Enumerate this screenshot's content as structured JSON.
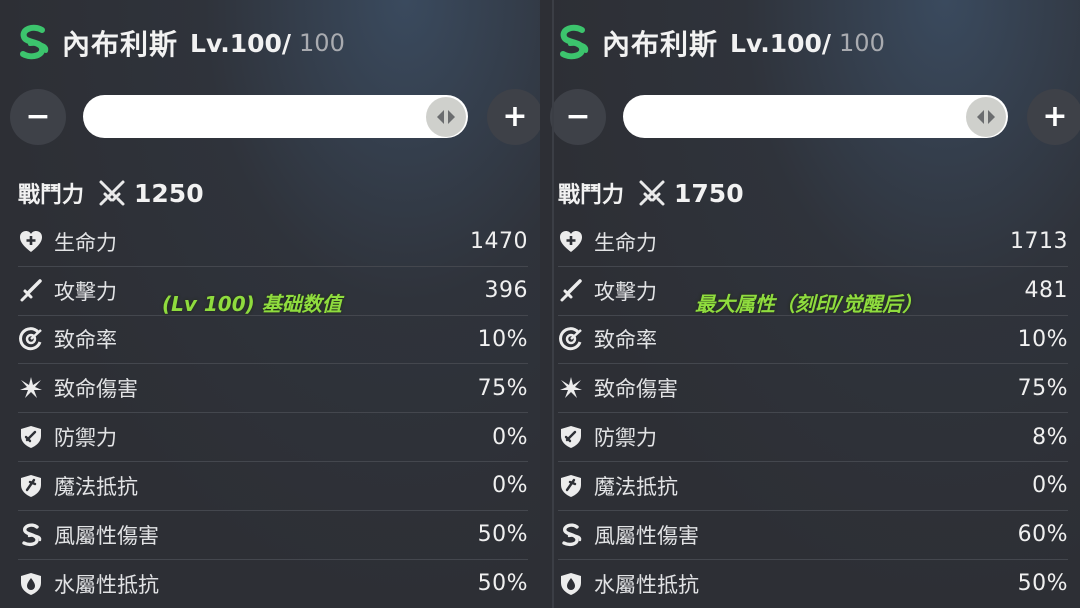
{
  "colors": {
    "accent_green": "#3cc46d",
    "overlay_green": "#8fdc3e",
    "panel_bg": "#2d2f35"
  },
  "panels": [
    {
      "name": "內布利斯",
      "level": "Lv.100/",
      "max_level": "100",
      "minus_label": "−",
      "plus_label": "+",
      "power_label": "戰鬥力",
      "power_value": "1250",
      "overlay": "(Lv 100) 基础数值",
      "stats": [
        {
          "icon": "heart-plus-icon",
          "label": "生命力",
          "value": "1470"
        },
        {
          "icon": "sword-icon",
          "label": "攻擊力",
          "value": "396"
        },
        {
          "icon": "crit-rate-icon",
          "label": "致命率",
          "value": "10%"
        },
        {
          "icon": "crit-damage-icon",
          "label": "致命傷害",
          "value": "75%"
        },
        {
          "icon": "shield-sword-icon",
          "label": "防禦力",
          "value": "0%"
        },
        {
          "icon": "magic-shield-icon",
          "label": "魔法抵抗",
          "value": "0%"
        },
        {
          "icon": "wind-icon",
          "label": "風屬性傷害",
          "value": "50%"
        },
        {
          "icon": "water-shield-icon",
          "label": "水屬性抵抗",
          "value": "50%"
        }
      ]
    },
    {
      "name": "內布利斯",
      "level": "Lv.100/",
      "max_level": "100",
      "minus_label": "−",
      "plus_label": "+",
      "power_label": "戰鬥力",
      "power_value": "1750",
      "overlay": "最大属性（刻印/觉醒后）",
      "stats": [
        {
          "icon": "heart-plus-icon",
          "label": "生命力",
          "value": "1713"
        },
        {
          "icon": "sword-icon",
          "label": "攻擊力",
          "value": "481"
        },
        {
          "icon": "crit-rate-icon",
          "label": "致命率",
          "value": "10%"
        },
        {
          "icon": "crit-damage-icon",
          "label": "致命傷害",
          "value": "75%"
        },
        {
          "icon": "shield-sword-icon",
          "label": "防禦力",
          "value": "8%"
        },
        {
          "icon": "magic-shield-icon",
          "label": "魔法抵抗",
          "value": "0%"
        },
        {
          "icon": "wind-icon",
          "label": "風屬性傷害",
          "value": "60%"
        },
        {
          "icon": "water-shield-icon",
          "label": "水屬性抵抗",
          "value": "50%"
        }
      ]
    }
  ]
}
